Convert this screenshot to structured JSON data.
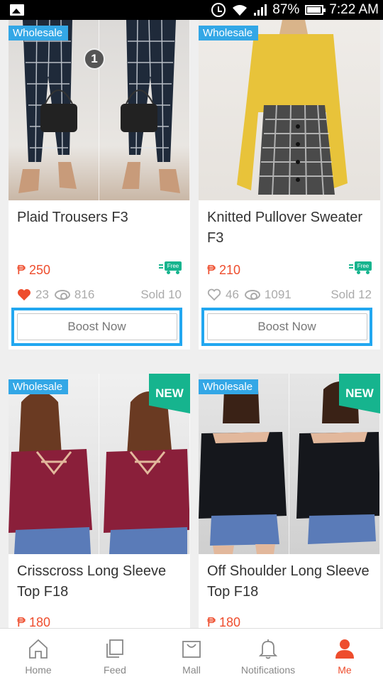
{
  "status_bar": {
    "battery": "87%",
    "time": "7:22 AM"
  },
  "colors": {
    "accent": "#ee4d2d",
    "wholesale_blue": "#33a7e6",
    "new_green": "#16b48e",
    "highlight_blue": "#22a7f0"
  },
  "products": [
    {
      "badge": "Wholesale",
      "photo_marker": "1",
      "title": "Plaid Trousers F3",
      "price": "₱ 250",
      "shipping_label": "Free",
      "likes": "23",
      "views": "816",
      "sold": "Sold 10",
      "liked": true,
      "boost_label": "Boost Now"
    },
    {
      "badge": "Wholesale",
      "title": "Knitted Pullover Sweater F3",
      "price": "₱ 210",
      "shipping_label": "Free",
      "likes": "46",
      "views": "1091",
      "sold": "Sold 12",
      "liked": false,
      "boost_label": "Boost Now"
    },
    {
      "badge": "Wholesale",
      "new_label": "NEW",
      "title": "Crisscross Long Sleeve Top F18",
      "price": "₱ 180"
    },
    {
      "badge": "Wholesale",
      "new_label": "NEW",
      "title": "Off Shoulder Long Sleeve Top F18",
      "price": "₱ 180"
    }
  ],
  "nav": {
    "items": [
      {
        "label": "Home",
        "icon": "home-icon"
      },
      {
        "label": "Feed",
        "icon": "feed-icon"
      },
      {
        "label": "Mall",
        "icon": "mall-bag-icon"
      },
      {
        "label": "Notifications",
        "icon": "bell-icon"
      },
      {
        "label": "Me",
        "icon": "person-icon",
        "active": true
      }
    ]
  }
}
